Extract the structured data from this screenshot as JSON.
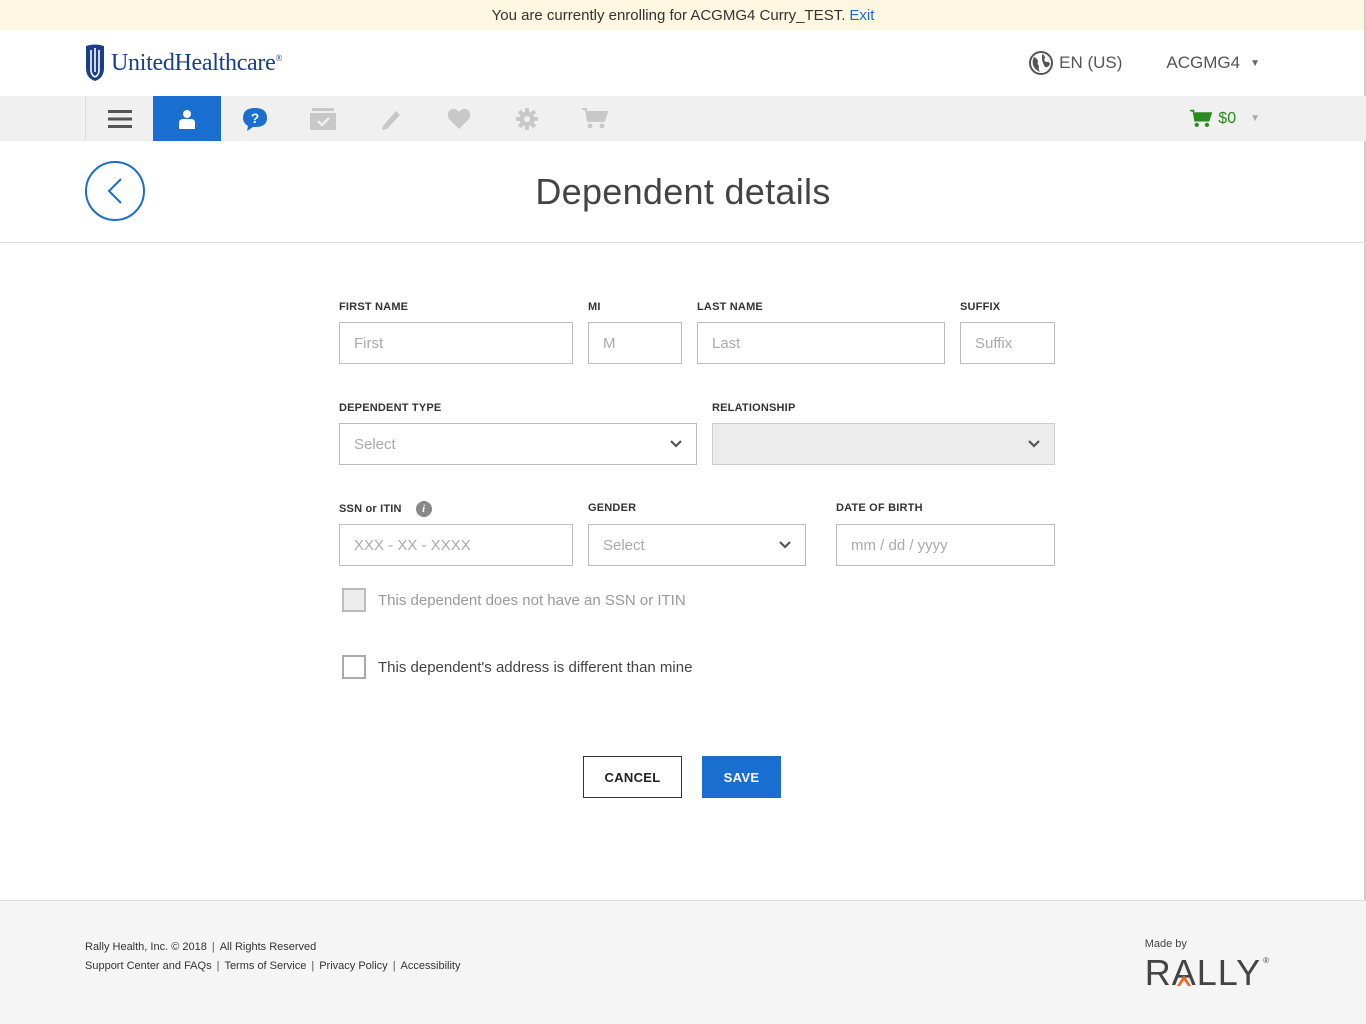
{
  "banner": {
    "message": "You are currently enrolling for ACGMG4 Curry_TEST.",
    "exit_label": "Exit"
  },
  "header": {
    "logo_text": "UnitedHealthcare",
    "logo_reg": "®",
    "language": "EN (US)",
    "user": "ACGMG4"
  },
  "nav": {
    "items": [
      {
        "icon": "menu-icon"
      },
      {
        "icon": "person-icon",
        "active": true
      },
      {
        "icon": "help-icon"
      },
      {
        "icon": "folder-check-icon"
      },
      {
        "icon": "pencil-icon"
      },
      {
        "icon": "heart-icon"
      },
      {
        "icon": "gear-icon"
      },
      {
        "icon": "cart-icon"
      }
    ],
    "cart_total": "$0",
    "colors": {
      "active_bg": "#196ecf",
      "help": "#196ecf",
      "disabled": "#c8c8c8",
      "cart": "#2a8a1f"
    }
  },
  "page": {
    "title": "Dependent details"
  },
  "form": {
    "first_name": {
      "label": "FIRST NAME",
      "placeholder": "First"
    },
    "mi": {
      "label": "MI",
      "placeholder": "M"
    },
    "last_name": {
      "label": "LAST NAME",
      "placeholder": "Last"
    },
    "suffix": {
      "label": "SUFFIX",
      "placeholder": "Suffix"
    },
    "dependent_type": {
      "label": "DEPENDENT TYPE",
      "value": "Select"
    },
    "relationship": {
      "label": "RELATIONSHIP",
      "value": ""
    },
    "ssn": {
      "label": "SSN or ITIN",
      "placeholder": "XXX - XX - XXXX",
      "info": "i"
    },
    "gender": {
      "label": "GENDER",
      "value": "Select"
    },
    "dob": {
      "label": "DATE OF BIRTH",
      "placeholder": "mm / dd / yyyy"
    },
    "no_ssn_checkbox": "This dependent does not have an SSN or ITIN",
    "address_checkbox": "This dependent's address is different than mine",
    "cancel_label": "CANCEL",
    "save_label": "SAVE"
  },
  "footer": {
    "copyright": "Rally Health, Inc. © 2018",
    "rights": "All Rights Reserved",
    "links": [
      "Support Center and FAQs",
      "Terms of Service",
      "Privacy Policy",
      "Accessibility"
    ],
    "made_by": "Made by",
    "brand": "RALLY",
    "brand_reg": "®",
    "brand_accent": "#e8692a"
  }
}
